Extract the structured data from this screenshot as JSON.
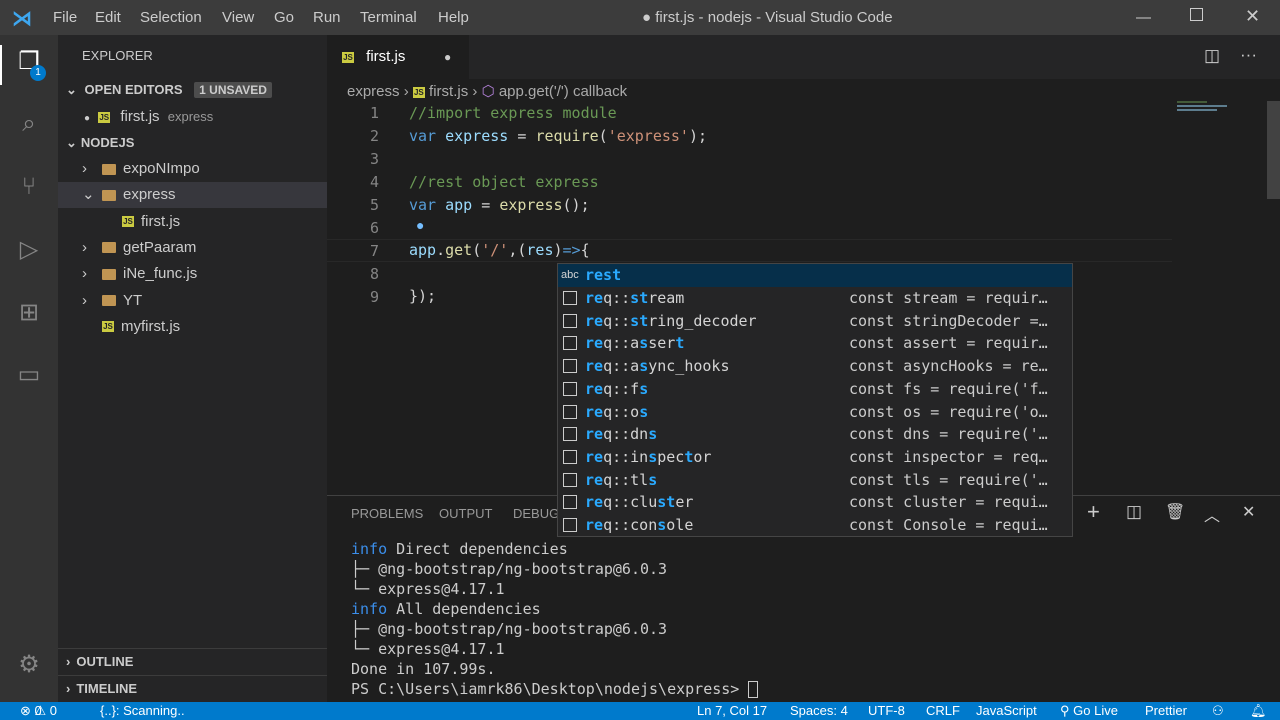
{
  "title": {
    "menus": [
      "File",
      "Edit",
      "Selection",
      "View",
      "Go",
      "Run",
      "Terminal",
      "Help"
    ],
    "window_title": "● first.js - nodejs - Visual Studio Code"
  },
  "activity": {
    "explorer_badge": "1"
  },
  "sidebar": {
    "header": "EXPLORER",
    "open_editors": "OPEN EDITORS",
    "unsaved": "1 UNSAVED",
    "open_file": "first.js",
    "open_file_dir": "express",
    "folder": "NODEJS",
    "tree": [
      {
        "label": "expoNImpo",
        "type": "folder"
      },
      {
        "label": "express",
        "type": "folder-open"
      },
      {
        "label": "first.js",
        "type": "file"
      },
      {
        "label": "getPaaram",
        "type": "folder"
      },
      {
        "label": "iNe_func.js",
        "type": "folder"
      },
      {
        "label": "YT",
        "type": "folder"
      },
      {
        "label": "myfirst.js",
        "type": "file-root"
      }
    ],
    "outline": "OUTLINE",
    "timeline": "TIMELINE"
  },
  "tab": {
    "label": "first.js"
  },
  "breadcrumb": {
    "folder": "express",
    "file": "first.js",
    "symbol": "app.get('/') callback"
  },
  "code": {
    "lines": [
      "1",
      "2",
      "3",
      "4",
      "5",
      "6",
      "7",
      "8",
      "9"
    ]
  },
  "suggest": {
    "query": "rest",
    "first": "rest",
    "items": [
      {
        "label": "req::stream",
        "detail": "const stream = requir…"
      },
      {
        "label": "req::string_decoder",
        "detail": "const stringDecoder =…"
      },
      {
        "label": "req::assert",
        "detail": "const assert = requir…"
      },
      {
        "label": "req::async_hooks",
        "detail": "const asyncHooks = re…"
      },
      {
        "label": "req::fs",
        "detail": "const fs = require('f…"
      },
      {
        "label": "req::os",
        "detail": "const os = require('o…"
      },
      {
        "label": "req::dns",
        "detail": "const dns = require('…"
      },
      {
        "label": "req::inspector",
        "detail": "const inspector = req…"
      },
      {
        "label": "req::tls",
        "detail": "const tls = require('…"
      },
      {
        "label": "req::cluster",
        "detail": "const cluster = requi…"
      },
      {
        "label": "req::console",
        "detail": "const Console = requi…"
      }
    ]
  },
  "panel": {
    "tabs": [
      "PROBLEMS",
      "OUTPUT",
      "DEBUG"
    ],
    "terminal": [
      "info Direct dependencies",
      "├─ @ng-bootstrap/ng-bootstrap@6.0.3",
      "└─ express@4.17.1",
      "info All dependencies",
      "├─ @ng-bootstrap/ng-bootstrap@6.0.3",
      "└─ express@4.17.1",
      "Done in 107.99s.",
      "PS C:\\Users\\iamrk86\\Desktop\\nodejs\\express> "
    ]
  },
  "status": {
    "errors": "0",
    "warnings": "0",
    "scanning": "{..}: Scanning..",
    "position": "Ln 7, Col 17",
    "spaces": "Spaces: 4",
    "encoding": "UTF-8",
    "eol": "CRLF",
    "language": "JavaScript",
    "golive": "Go Live",
    "prettier": "Prettier"
  }
}
